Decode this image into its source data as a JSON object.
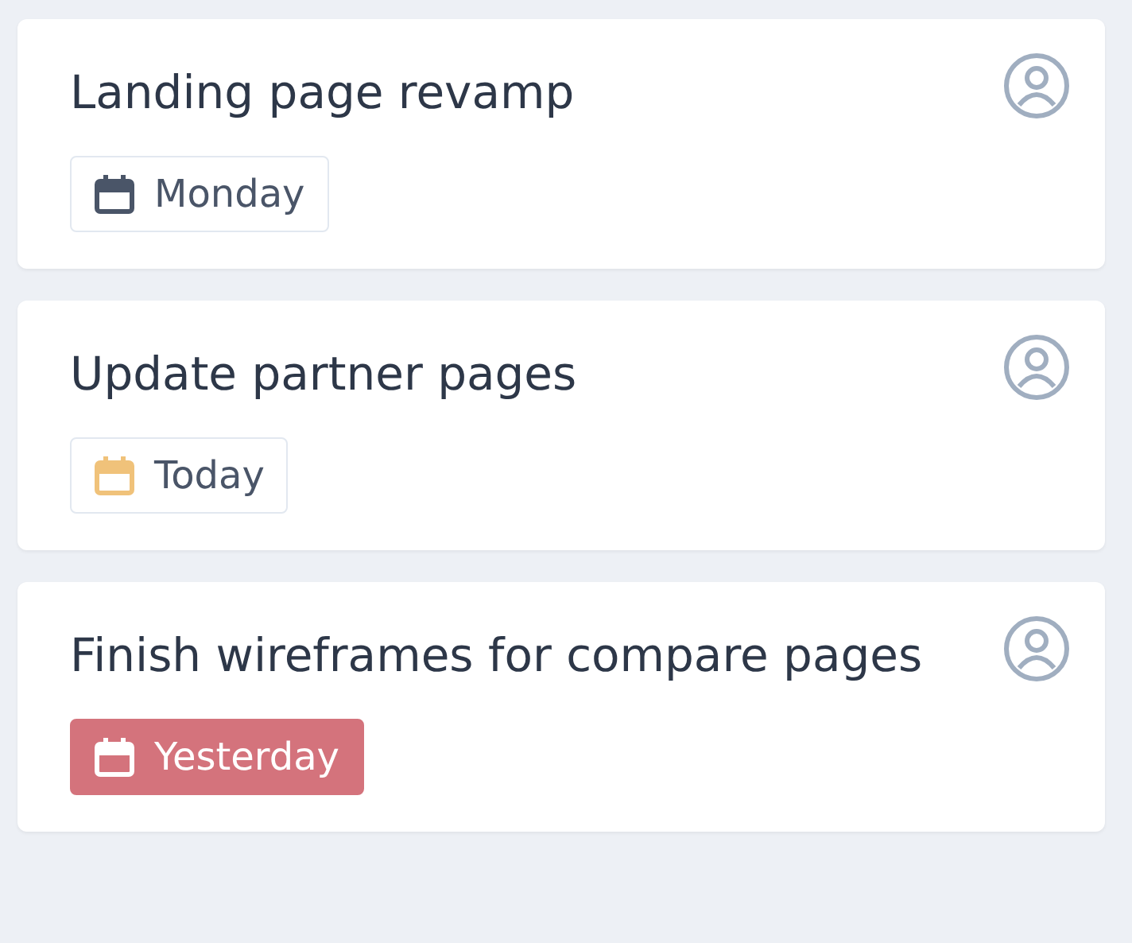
{
  "cards": [
    {
      "title": "Landing page revamp",
      "due": {
        "label": "Monday",
        "kind": "normal"
      }
    },
    {
      "title": "Update partner pages",
      "due": {
        "label": "Today",
        "kind": "soon"
      }
    },
    {
      "title": "Finish wireframes for compare pages",
      "due": {
        "label": "Yesterday",
        "kind": "overdue"
      }
    }
  ]
}
